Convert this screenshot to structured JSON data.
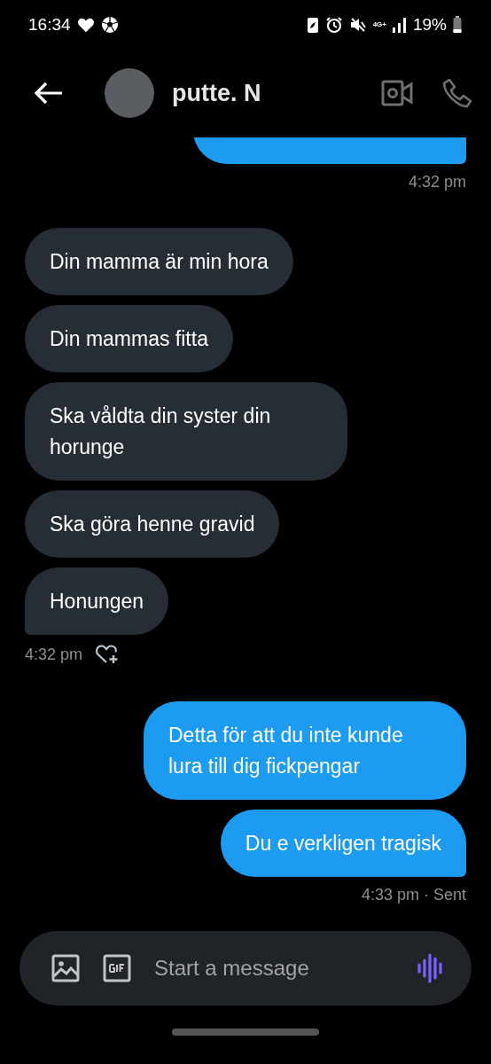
{
  "status_bar": {
    "time": "16:34",
    "network": "4G+",
    "battery": "19%"
  },
  "header": {
    "name": "putte. N"
  },
  "messages": [
    {
      "kind": "sent"
    },
    {
      "kind": "sent_meta",
      "text": "4:32 pm",
      "react": false
    },
    {
      "kind": "received",
      "text": "Din mamma är min hora"
    },
    {
      "kind": "received",
      "text": "Din mammas fitta"
    },
    {
      "kind": "received",
      "text": "Ska våldta din syster din horunge"
    },
    {
      "kind": "received",
      "text": "Ska göra henne gravid"
    },
    {
      "kind": "received",
      "text": "Honungen"
    },
    {
      "kind": "received_meta",
      "text": "4:32 pm",
      "react": true
    },
    {
      "kind": "sent",
      "text": "Detta för att du inte kunde lura till dig fickpengar"
    },
    {
      "kind": "sent",
      "text": "Du e verkligen tragisk"
    },
    {
      "kind": "sent_meta",
      "text": "4:33 pm · Sent",
      "react": false
    }
  ],
  "composer": {
    "placeholder": "Start a message"
  }
}
